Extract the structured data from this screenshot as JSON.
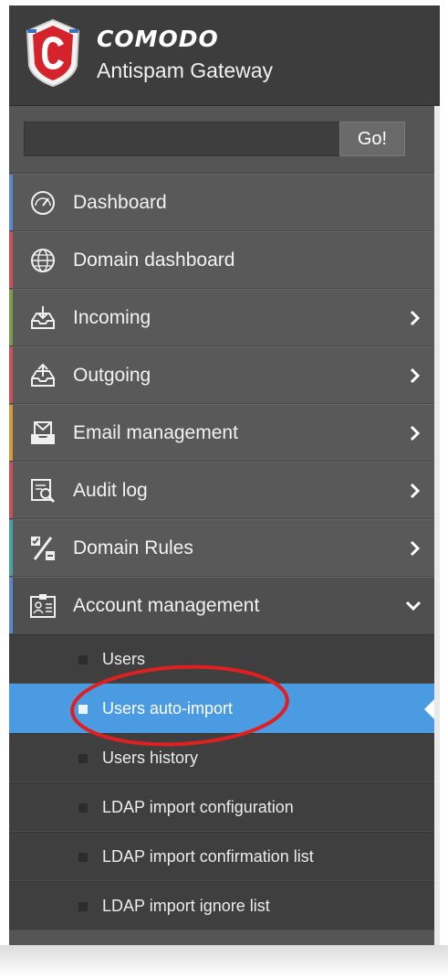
{
  "brand": {
    "name": "COMODO",
    "product": "Antispam Gateway"
  },
  "search": {
    "value": "",
    "button_label": "Go!"
  },
  "nav": [
    {
      "label": "Dashboard",
      "icon": "speedometer-icon",
      "accent": "#5b86c8",
      "has_submenu": false
    },
    {
      "label": "Domain dashboard",
      "icon": "globe-icon",
      "accent": "#c8505a",
      "has_submenu": false
    },
    {
      "label": "Incoming",
      "icon": "inbox-download-icon",
      "accent": "#7a9a4a",
      "has_submenu": true
    },
    {
      "label": "Outgoing",
      "icon": "outbox-upload-icon",
      "accent": "#c8505a",
      "has_submenu": true
    },
    {
      "label": "Email management",
      "icon": "envelope-tray-icon",
      "accent": "#d39a3a",
      "has_submenu": true
    },
    {
      "label": "Audit log",
      "icon": "log-search-icon",
      "accent": "#c8505a",
      "has_submenu": true
    },
    {
      "label": "Domain Rules",
      "icon": "percent-rules-icon",
      "accent": "#4aa0a0",
      "has_submenu": true
    },
    {
      "label": "Account management",
      "icon": "id-card-icon",
      "accent": "#5b86c8",
      "has_submenu": true,
      "expanded": true
    }
  ],
  "submenu": [
    {
      "label": "Users",
      "active": false
    },
    {
      "label": "Users auto-import",
      "active": true
    },
    {
      "label": "Users history",
      "active": false
    },
    {
      "label": "LDAP import configuration",
      "active": false
    },
    {
      "label": "LDAP import confirmation list",
      "active": false
    },
    {
      "label": "LDAP import ignore list",
      "active": false
    }
  ],
  "colors": {
    "active": "#4b9be3",
    "sidebar": "#555555",
    "annotation": "#e02020"
  }
}
